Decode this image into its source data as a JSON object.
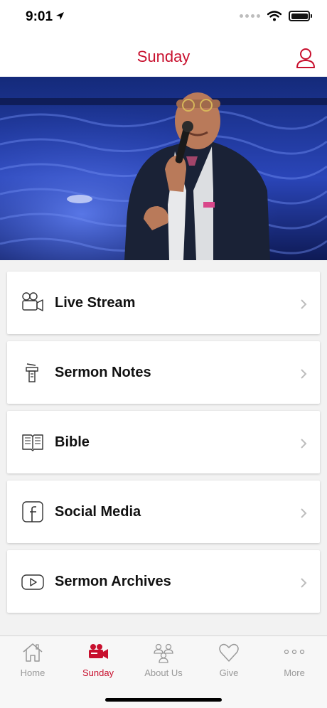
{
  "status_bar": {
    "time": "9:01"
  },
  "nav": {
    "title": "Sunday"
  },
  "menu": [
    {
      "label": "Live Stream",
      "icon": "video-camera-icon"
    },
    {
      "label": "Sermon Notes",
      "icon": "pulpit-icon"
    },
    {
      "label": "Bible",
      "icon": "book-icon"
    },
    {
      "label": "Social Media",
      "icon": "facebook-icon"
    },
    {
      "label": "Sermon Archives",
      "icon": "youtube-play-icon"
    }
  ],
  "tabs": [
    {
      "label": "Home",
      "icon": "home-icon",
      "active": false
    },
    {
      "label": "Sunday",
      "icon": "video-camera-icon",
      "active": true
    },
    {
      "label": "About Us",
      "icon": "people-icon",
      "active": false
    },
    {
      "label": "Give",
      "icon": "heart-icon",
      "active": false
    },
    {
      "label": "More",
      "icon": "more-dots-icon",
      "active": false
    }
  ],
  "colors": {
    "accent": "#c8102e",
    "inactive": "#999999",
    "background": "#f2f2f2"
  }
}
